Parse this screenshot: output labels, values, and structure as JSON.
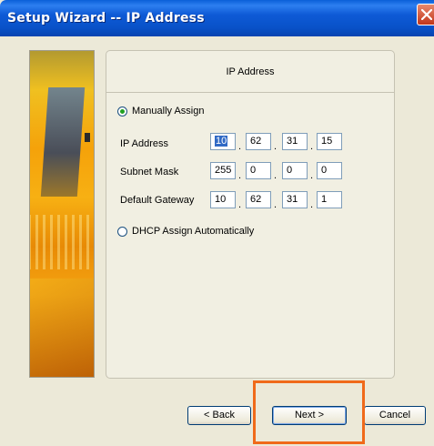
{
  "window": {
    "title": "Setup Wizard -- IP Address"
  },
  "panel": {
    "title": "IP Address"
  },
  "options": {
    "manual_label": "Manually Assign",
    "dhcp_label": "DHCP Assign Automatically",
    "selected": "manual"
  },
  "fields": [
    {
      "label": "IP Address",
      "octets": [
        "10",
        "62",
        "31",
        "15"
      ]
    },
    {
      "label": "Subnet Mask",
      "octets": [
        "255",
        "0",
        "0",
        "0"
      ]
    },
    {
      "label": "Default Gateway",
      "octets": [
        "10",
        "62",
        "31",
        "1"
      ]
    }
  ],
  "separator": ".",
  "buttons": {
    "back": "< Back",
    "next": "Next >",
    "cancel": "Cancel"
  },
  "colors": {
    "titlebar": "#0a5fd8",
    "highlight": "#f06a1a",
    "selection": "#316ac5"
  },
  "icons": {
    "close": "close-icon"
  }
}
